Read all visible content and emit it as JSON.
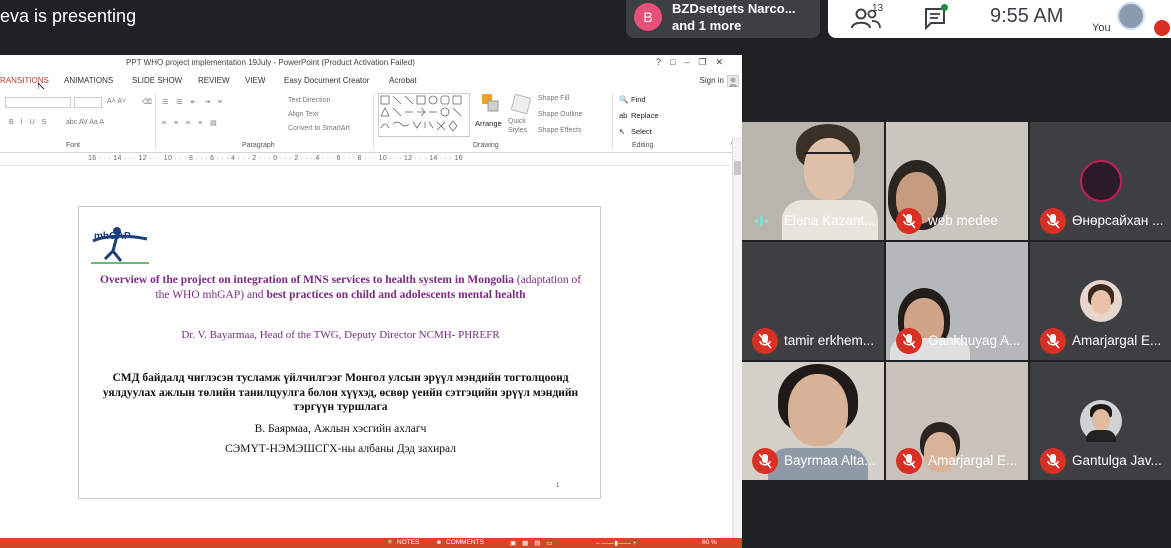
{
  "meet": {
    "presenting_text": "eva is presenting",
    "notification": {
      "avatar_letter": "B",
      "line1": "BZDsetgets Narco...",
      "line2": "and 1 more"
    },
    "people_count": "13",
    "time": "9:55 AM",
    "you_label": "You",
    "colors": {
      "background": "#202124",
      "tile": "#3c4043",
      "mic_off": "#d93025",
      "notification_avatar": "#e8507a"
    }
  },
  "ppt": {
    "window_title": "PPT WHO project implementation 19July - PowerPoint (Product Activation Failed)",
    "tabs": [
      "RANSITIONS",
      "ANIMATIONS",
      "SLIDE SHOW",
      "REVIEW",
      "VIEW",
      "Easy Document Creator",
      "Acrobat"
    ],
    "sign_in": "Sign in",
    "ribbon": {
      "groups": [
        "Font",
        "Paragraph",
        "Drawing",
        "Editing"
      ],
      "text_direction": "Text Direction",
      "align_text": "Align Text",
      "convert_smartart": "Convert to SmartArt",
      "arrange": "Arrange",
      "quick_styles": "Quick Styles",
      "shape_fill": "Shape Fill",
      "shape_outline": "Shape Outline",
      "shape_effects": "Shape Effects",
      "find": "Find",
      "replace": "Replace",
      "select": "Select"
    },
    "ruler": "16 · · · 14 · · · 12 · · · 10 · · · 8 · · · 6 · · · 4 · · · 2 · · · 0 · · · 2 · · · 4 · · · 6 · · · 8 · · · 10 · · · 12 · · · 14 · · · 16",
    "slide": {
      "logo_text": "mhGAP",
      "title_bold1": "Overview of the project on integration of MNS services to health system in Mongolia",
      "title_normal": " (adaptation of the WHO mhGAP) and ",
      "title_bold2": "best practices on child and adolescents mental health",
      "author": "Dr. V. Bayarmaa, Head of the TWG, Deputy Director NCMH- PHREFR",
      "mn_title": "СМД байдалд чиглэсэн тусламж үйлчилгээг Монгол улсын эрүүл мэндийн тогтолцоонд уялдуулах ажлын төлийн танилцуулга болон хүүхэд, өсвөр үеийн сэтгэцийн эрүүл мэндийн тэргүүн туршлага",
      "mn_author": "В. Баярмаа, Ажлын хэсгийн ахлагч",
      "mn_org": "СЭМҮТ-НЭМЭШСГХ-ны албаны  Дэд захирал",
      "page_number": "1"
    },
    "status": {
      "notes": "NOTES",
      "comments": "COMMENTS",
      "zoom": "60 %"
    }
  },
  "participants": [
    {
      "name": "Elena Kazant...",
      "muted": false
    },
    {
      "name": "web medee",
      "muted": true
    },
    {
      "name": "Өнөрсайхан ...",
      "muted": true
    },
    {
      "name": "tamir erkhem...",
      "muted": true
    },
    {
      "name": "Gankhuyag A...",
      "muted": true
    },
    {
      "name": "Amarjargal E...",
      "muted": true
    },
    {
      "name": "Bayrmaa Alta...",
      "muted": true
    },
    {
      "name": "Amarjargal E...",
      "muted": true
    },
    {
      "name": "Gantulga Jav...",
      "muted": true
    }
  ]
}
